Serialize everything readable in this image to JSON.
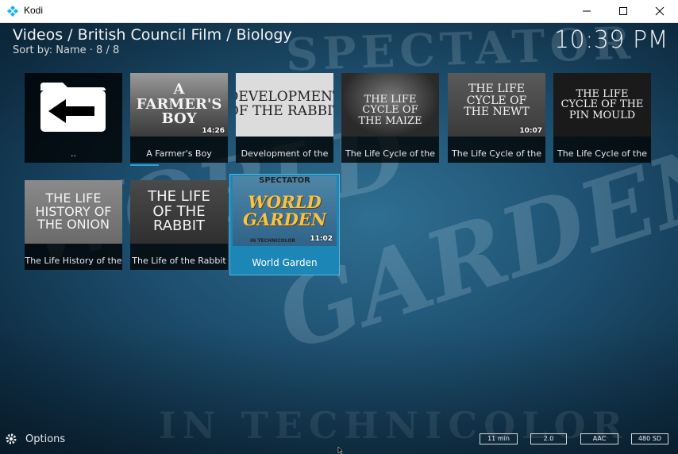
{
  "window": {
    "title": "Kodi",
    "icon": "kodi-logo-icon"
  },
  "header": {
    "breadcrumb": "Videos / British Council Film / Biology",
    "sort_info": "Sort by: Name · 8 / 8",
    "clock": "10:39 PM"
  },
  "grid": {
    "items": [
      {
        "label": "..",
        "type": "parent-folder",
        "thumb_text": ""
      },
      {
        "label": "A Farmer's Boy",
        "thumb_text": "A FARMER'S BOY",
        "duration": "14:26"
      },
      {
        "label": "Development of the",
        "thumb_text": "DEVELOPMENT OF THE RABBIT"
      },
      {
        "label": "The Life Cycle of the",
        "thumb_text": "THE LIFE CYCLE OF THE MAIZE"
      },
      {
        "label": "The Life Cycle of the",
        "thumb_text": "THE LIFE CYCLE OF THE NEWT",
        "duration": "10:07"
      },
      {
        "label": "The Life Cycle of the",
        "thumb_text": "THE LIFE CYCLE OF THE PIN MOULD"
      },
      {
        "label": "The Life History of the",
        "thumb_text": "THE LIFE HISTORY OF THE ONION"
      },
      {
        "label": "The Life of the Rabbit",
        "thumb_text": "THE LIFE OF THE RABBIT"
      },
      {
        "label": "World Garden",
        "thumb_text": "WORLD GARDEN",
        "thumb_top": "SPECTATOR",
        "thumb_bottom": "IN TECHNICOLOR",
        "duration": "11:02",
        "focused": true
      }
    ]
  },
  "footer": {
    "options_label": "Options",
    "badges": [
      "11 min",
      "2.0",
      "AAC",
      "480 SD"
    ]
  },
  "background": {
    "texts": [
      "SPECTATOR",
      "WORLD",
      "GARDEN",
      "IN TECHNICOLOR"
    ]
  },
  "colors": {
    "focus": "#1c86b7",
    "accent": "#2aa1d6",
    "kodi_blue": "#17b2e7"
  }
}
